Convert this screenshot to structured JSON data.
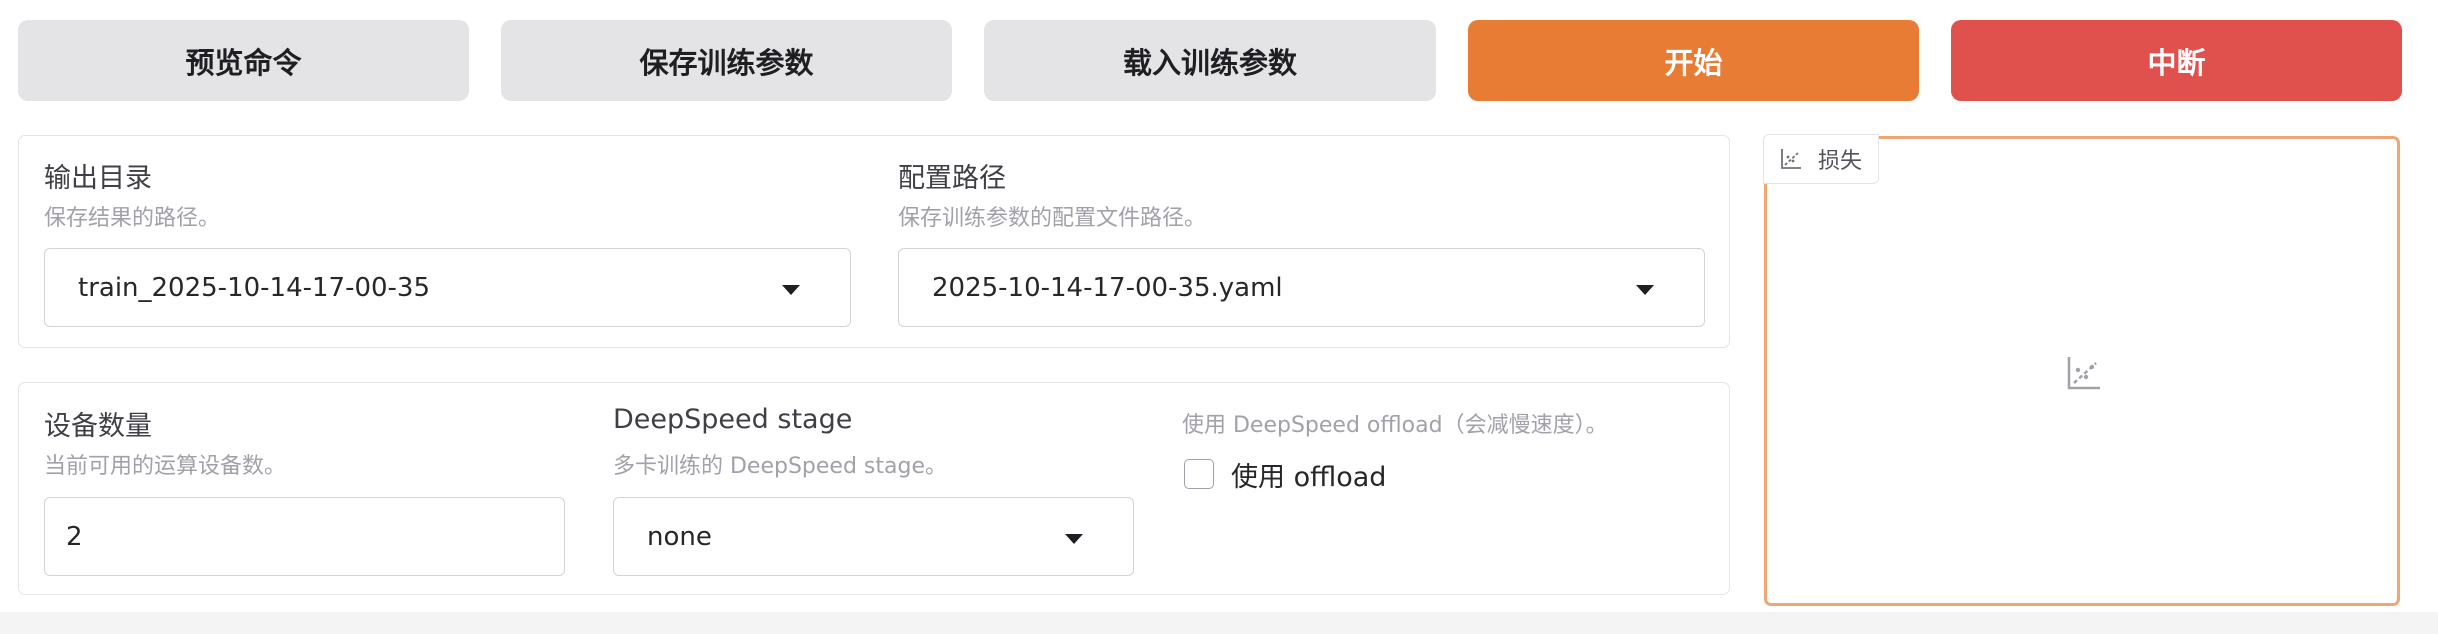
{
  "actions": {
    "preview_label": "预览命令",
    "save_label": "保存训练参数",
    "load_label": "载入训练参数",
    "start_label": "开始",
    "stop_label": "中断"
  },
  "output": {
    "output_dir": {
      "label": "输出目录",
      "info": "保存结果的路径。",
      "value": "train_2025-10-14-17-00-35"
    },
    "config_path": {
      "label": "配置路径",
      "info": "保存训练参数的配置文件路径。",
      "value": "2025-10-14-17-00-35.yaml"
    }
  },
  "devices": {
    "device_count": {
      "label": "设备数量",
      "info": "当前可用的运算设备数。",
      "value": "2"
    },
    "ds_stage": {
      "label": "DeepSpeed stage",
      "info": "多卡训练的 DeepSpeed stage。",
      "value": "none"
    },
    "ds_offload": {
      "info": "使用 DeepSpeed offload（会减慢速度）。",
      "checkbox_label": "使用 offload",
      "checked": false
    }
  },
  "loss_plot": {
    "label": "损失",
    "icon": "chart-icon",
    "empty_icon": "chart-placeholder-icon"
  },
  "colors": {
    "primary": "#e97c35",
    "stop": "#e0514e",
    "secondary": "#e4e4e7",
    "focus_border": "#f0a674"
  }
}
